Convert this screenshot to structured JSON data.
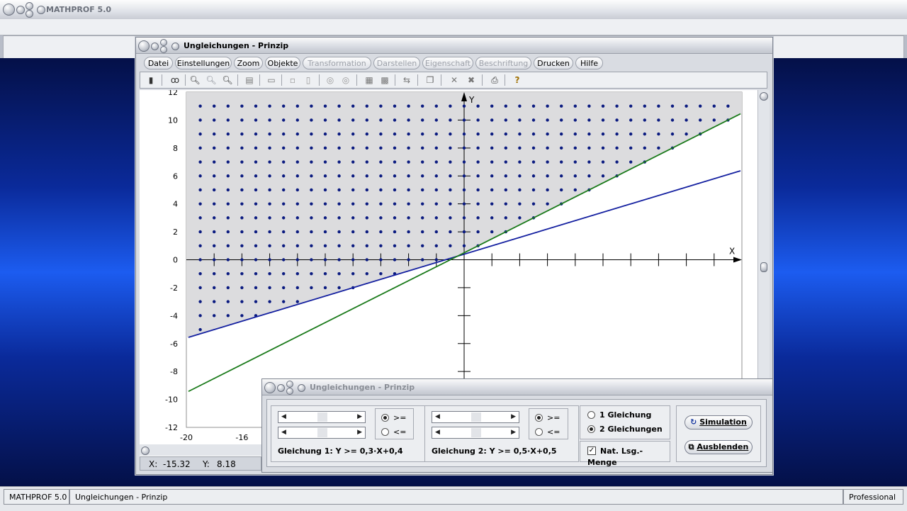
{
  "app": {
    "title": "MATHPROF 5.0"
  },
  "window": {
    "title": "Ungleichungen - Prinzip",
    "menu": [
      {
        "label": "Datei",
        "enabled": true
      },
      {
        "label": "Einstellungen",
        "enabled": true
      },
      {
        "label": "Zoom",
        "enabled": true
      },
      {
        "label": "Objekte",
        "enabled": true
      },
      {
        "label": "Transformation",
        "enabled": false
      },
      {
        "label": "Darstellen",
        "enabled": false
      },
      {
        "label": "Eigenschaft",
        "enabled": false
      },
      {
        "label": "Beschriftung",
        "enabled": false
      },
      {
        "label": "Drucken",
        "enabled": true
      },
      {
        "label": "Hilfe",
        "enabled": true
      }
    ],
    "toolbar_icons": [
      "calculator-icon",
      "glasses-icon",
      "zoom-out-icon",
      "zoom-icon",
      "zoom-in-icon",
      "properties-icon",
      "window-icon",
      "small-box-icon",
      "frame-icon",
      "circle-a-icon",
      "circle-b-icon",
      "table-icon",
      "table-edit-icon",
      "export-icon",
      "copy-icon",
      "cross-icon",
      "double-cross-icon",
      "print-icon",
      "help-icon"
    ],
    "coords": {
      "x_label": "X:",
      "x_value": "-15.32",
      "y_label": "Y:",
      "y_value": "8.18"
    }
  },
  "chart_data": {
    "type": "line",
    "title": "",
    "xlabel": "X",
    "ylabel": "Y",
    "xlim": [
      -20,
      20
    ],
    "ylim": [
      -12,
      12
    ],
    "x_ticks_labeled": [
      "-20",
      "-16"
    ],
    "y_ticks": [
      "12",
      "10",
      "8",
      "6",
      "4",
      "2",
      "0",
      "-2",
      "-4",
      "-6",
      "-8",
      "-10",
      "-12"
    ],
    "grid": false,
    "series": [
      {
        "name": "Gleichung 1",
        "slope": 0.3,
        "intercept": 0.4,
        "color": "#1420a0"
      },
      {
        "name": "Gleichung 2",
        "slope": 0.5,
        "intercept": 0.5,
        "color": "#1a7a1a"
      }
    ],
    "solution_region": {
      "rule": "y >= 0.3x+0.4 and y >= 0.5x+0.5",
      "fill": "#dcdcde",
      "dot_color": "#0a1a80",
      "dot_step": 1
    }
  },
  "dialog": {
    "title": "Ungleichungen - Prinzip",
    "eq1": {
      "ge_label": ">=",
      "le_label": "<=",
      "selected": "ge",
      "text": "Gleichung 1: Y >= 0,3·X+0,4"
    },
    "eq2": {
      "ge_label": ">=",
      "le_label": "<=",
      "selected": "ge",
      "text": "Gleichung 2: Y >= 0,5·X+0,5"
    },
    "mode_one": "1 Gleichung",
    "mode_two": "2 Gleichungen",
    "mode_selected": "two",
    "nat_check_label": "Nat. Lsg.-Menge",
    "nat_checked": true,
    "simulation_label": "Simulation",
    "hide_label": "Ausblenden"
  },
  "status": {
    "app": "MATHPROF 5.0",
    "doc": "Ungleichungen - Prinzip",
    "edition": "Professional"
  }
}
